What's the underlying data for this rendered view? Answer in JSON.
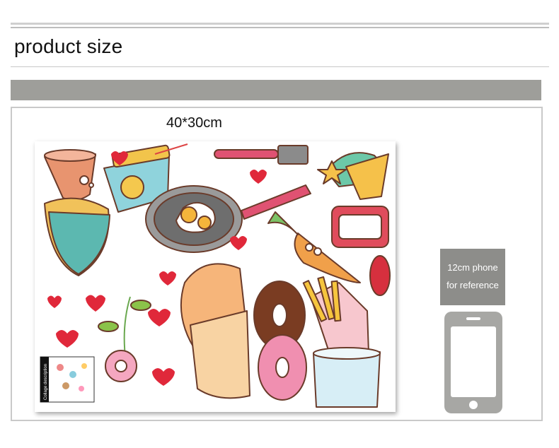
{
  "header": {
    "title": "product size"
  },
  "product": {
    "dimension_label": "40*30cm",
    "collage_label": "Collage description"
  },
  "reference": {
    "line1": "12cm phone",
    "line2": "for reference"
  }
}
